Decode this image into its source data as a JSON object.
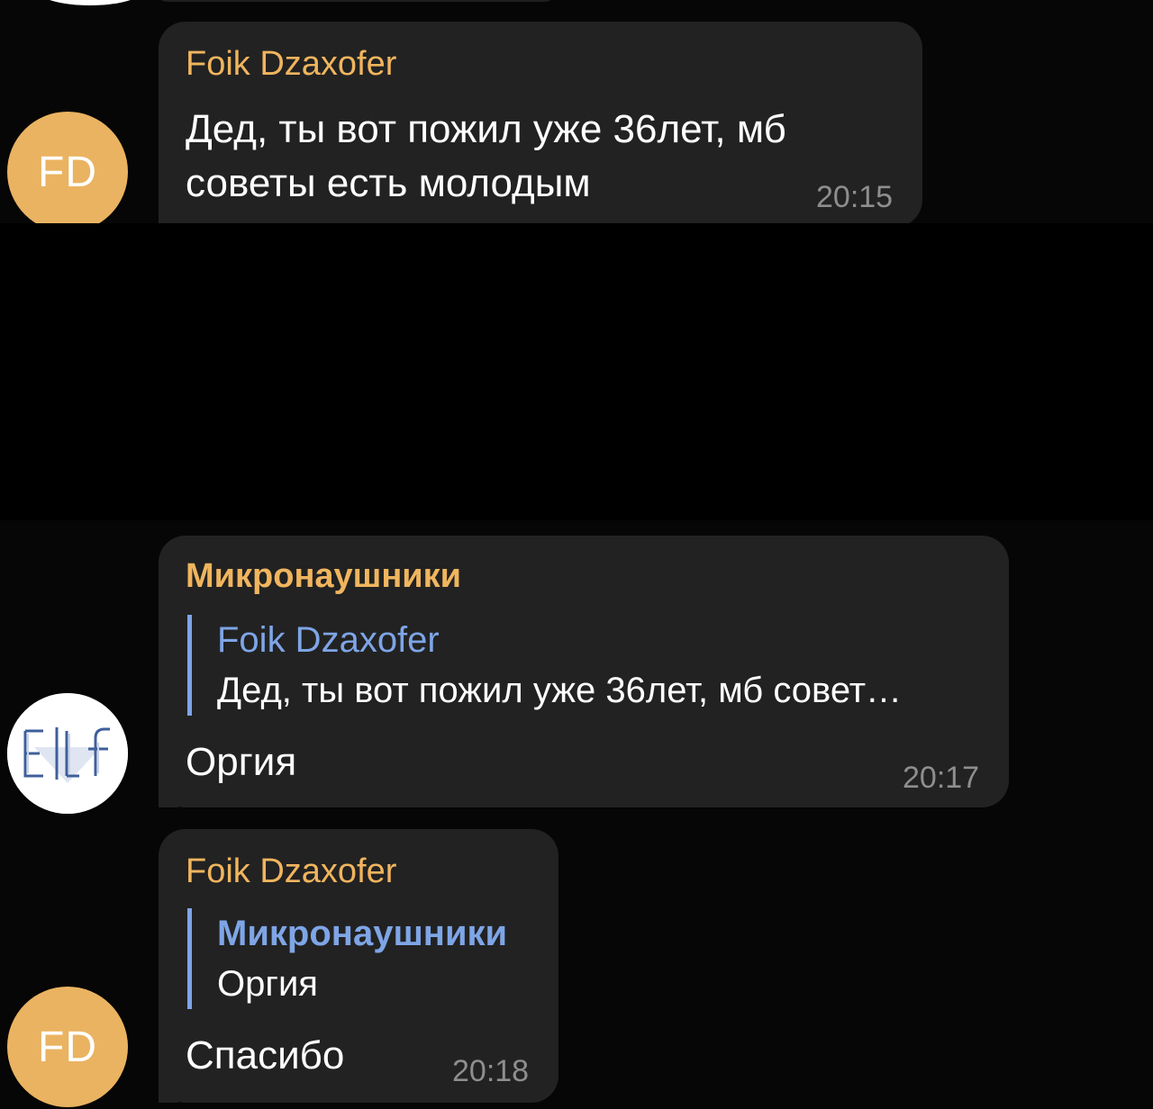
{
  "messages": [
    {
      "sender": "Foik Dzaxofer",
      "avatar_initials": "FD",
      "text": "Дед, ты вот пожил уже 36лет, мб\nсоветы есть молодым",
      "time": "20:15"
    },
    {
      "sender": "Микронаушники",
      "avatar_text": "Elf",
      "reply": {
        "name": "Foik Dzaxofer",
        "text": "Дед, ты вот пожил уже 36лет, мб совет…"
      },
      "text": "Оргия",
      "time": "20:17"
    },
    {
      "sender": "Foik Dzaxofer",
      "avatar_initials": "FD",
      "reply": {
        "name": "Микронаушники",
        "text": "Оргия"
      },
      "text": "Спасибо",
      "time": "20:18"
    }
  ],
  "colors": {
    "background": "#060606",
    "bubble": "#222222",
    "sender_name": "#f0b55e",
    "reply_accent": "#7ea5e6",
    "timestamp": "#8e8e8e",
    "fd_avatar": "#eab361"
  }
}
